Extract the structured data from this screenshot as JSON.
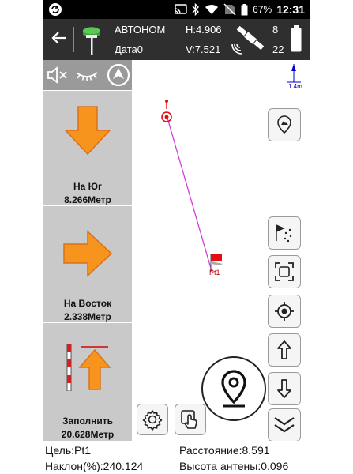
{
  "status_bar": {
    "battery_percent": "67%",
    "time": "12:31",
    "icons": [
      "app-badge-icon",
      "cast-icon",
      "bluetooth-icon",
      "wifi-icon",
      "no-sim-icon",
      "battery-icon"
    ]
  },
  "header": {
    "mode": "АВТОНОМ",
    "date_label": "Дата0",
    "h_value": "H:4.906",
    "v_value": "V:7.521",
    "sat_used": "8",
    "sat_visible": "22"
  },
  "nav": {
    "south": {
      "label": "На Юг",
      "value": "8.266Метр"
    },
    "east": {
      "label": "На Восток",
      "value": "2.338Метр"
    },
    "fill": {
      "label": "Заполнить",
      "value": "20.628Метр"
    }
  },
  "map": {
    "point_label": "Pt1",
    "scale_label": "1.4m"
  },
  "info": {
    "target": "Цель:Pt1",
    "distance": "Расстояние:8.591",
    "slope": "Наклон(%):240.124",
    "antenna_height": "Высота антены:0.096"
  },
  "colors": {
    "arrow_orange": "#f7941d",
    "header_bg": "#2f2f2f",
    "panel_bg": "#c9c9c9",
    "track_line": "#d63adb",
    "target_flag": "#e01010"
  }
}
